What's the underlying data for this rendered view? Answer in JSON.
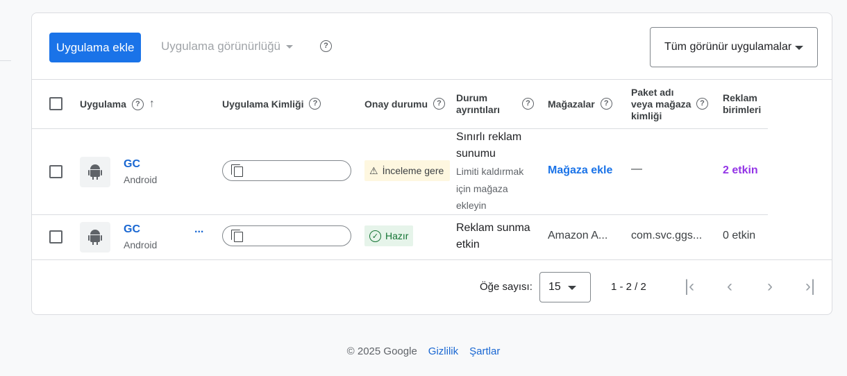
{
  "toolbar": {
    "add_app_label": "Uygulama ekle",
    "visibility_label": "Uygulama görünürlüğü",
    "filter_value": "Tüm görünür uygulamalar"
  },
  "table": {
    "headers": {
      "app": "Uygulama",
      "app_id": "Uygulama Kimliği",
      "approval": "Onay durumu",
      "status_details": "Durum ayrıntıları",
      "stores": "Mağazalar",
      "package": "Paket adı veya mağaza kimliği",
      "ad_units": "Reklam birimleri"
    },
    "rows": [
      {
        "app_name": "GC",
        "platform": "Android",
        "approval": "İnceleme gere",
        "status_main": "Sınırlı reklam sunumu",
        "status_sub": "Limiti kaldırmak için mağaza ekleyin",
        "store": "Mağaza ekle",
        "package": "—",
        "ad_units": "2 etkin"
      },
      {
        "app_name": "GC",
        "app_name_suffix": "...",
        "platform": "Android",
        "approval": "Hazır",
        "status_main": "Reklam sunma etkin",
        "store": "Amazon A...",
        "package": "com.svc.ggs...",
        "ad_units": "0 etkin"
      }
    ]
  },
  "pager": {
    "label": "Öğe sayısı:",
    "page_size": "15",
    "range": "1 - 2 / 2"
  },
  "footer": {
    "copyright": "© 2025 Google",
    "privacy": "Gizlilik",
    "terms": "Şartlar"
  },
  "colors": {
    "primary": "#1a73e8",
    "link": "#1967d2",
    "active_purple": "#9334e6",
    "warning_bg": "#fef7e0",
    "success_bg": "#e6f4ea"
  }
}
